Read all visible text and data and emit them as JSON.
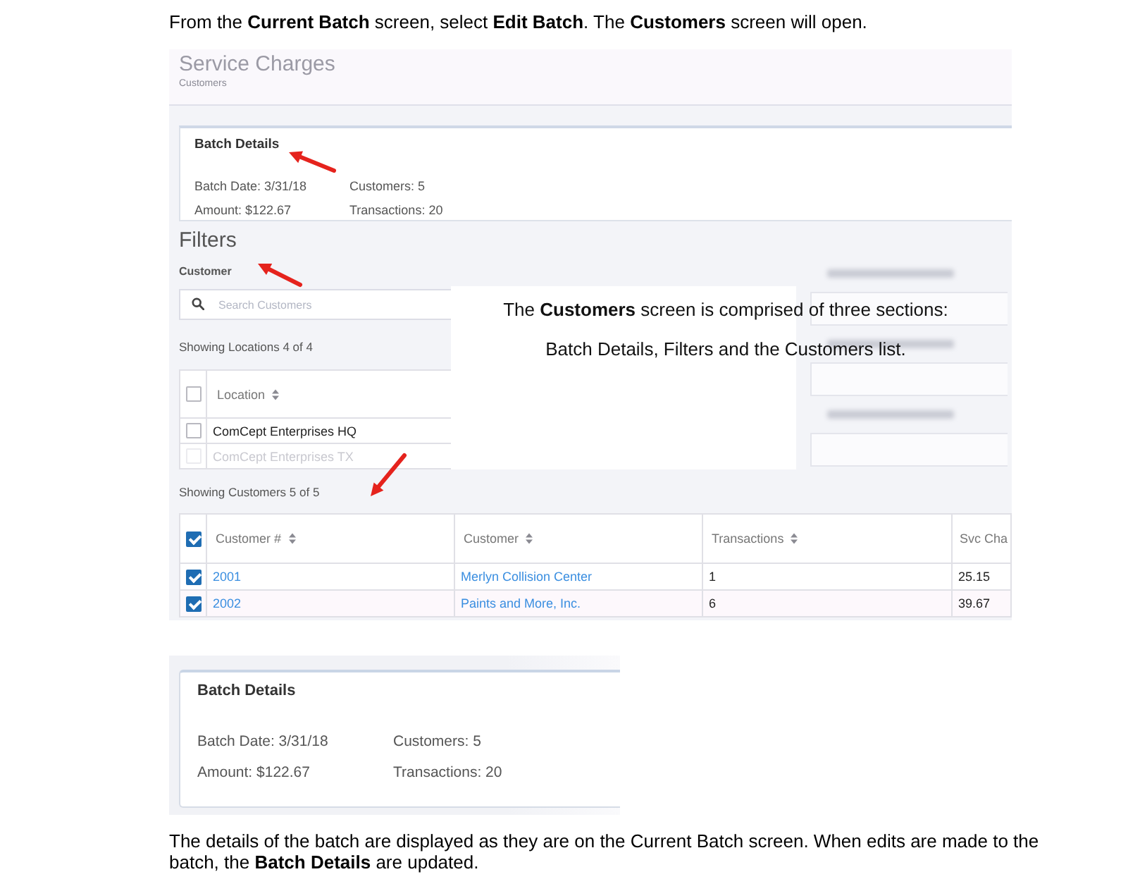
{
  "intro": "From the **Current Batch** screen, select **Edit Batch**. The **Customers** screen will open.",
  "screenshot": {
    "header": {
      "title": "Service Charges",
      "subtitle": "Customers"
    },
    "batch_details": {
      "title": "Batch Details",
      "arrow": true,
      "fields": [
        "Batch Date: 3/31/18",
        "Customers: 5",
        "Amount: $122.67",
        "Transactions: 20"
      ]
    },
    "filters": {
      "title": "Filters",
      "arrow": true,
      "customer_label": "Customer",
      "search": {
        "placeholder": "Search Customers"
      },
      "locations_count": "Showing Locations 4 of 4",
      "locations_table": {
        "header_checked": false,
        "columns": [
          {
            "label": "Location",
            "sortable": true
          }
        ],
        "rows": [
          {
            "location": "ComCept Enterprises HQ",
            "checked": false,
            "faded": false
          },
          {
            "location": "ComCept Enterprises TX",
            "checked": false,
            "faded": true
          }
        ]
      }
    },
    "side_filters": [
      {
        "blurred": true
      },
      {
        "blurred": true
      },
      {
        "blurred": true
      }
    ],
    "callout": {
      "lines": [
        "The **Customers** screen is comprised of three sections:",
        "Batch Details, Filters and the Customers list."
      ]
    },
    "customers": {
      "count": "Showing Customers 5 of 5",
      "arrow": true,
      "header_checked": true,
      "columns": [
        {
          "label": "Customer #",
          "sortable": true,
          "kind": "link"
        },
        {
          "label": "Customer",
          "sortable": true,
          "kind": "link"
        },
        {
          "label": "Transactions",
          "sortable": true,
          "kind": "text"
        },
        {
          "label": "Svc Cha",
          "kind": "text"
        }
      ],
      "rows": [
        {
          "checked": true,
          "cells": [
            "2001",
            "Merlyn Collision Center",
            "1",
            "25.15"
          ]
        },
        {
          "checked": true,
          "cells": [
            "2002",
            "Paints and More, Inc.",
            "6",
            "39.67"
          ]
        }
      ]
    }
  },
  "detail_figure": {
    "title": "Batch Details",
    "fields": [
      "Batch Date: 3/31/18",
      "Customers: 5",
      "Amount: $122.67",
      "Transactions: 20"
    ]
  },
  "outro": "The details of the batch are displayed as they are on the Current Batch screen. When edits are made to the batch, the **Batch Details** are updated."
}
